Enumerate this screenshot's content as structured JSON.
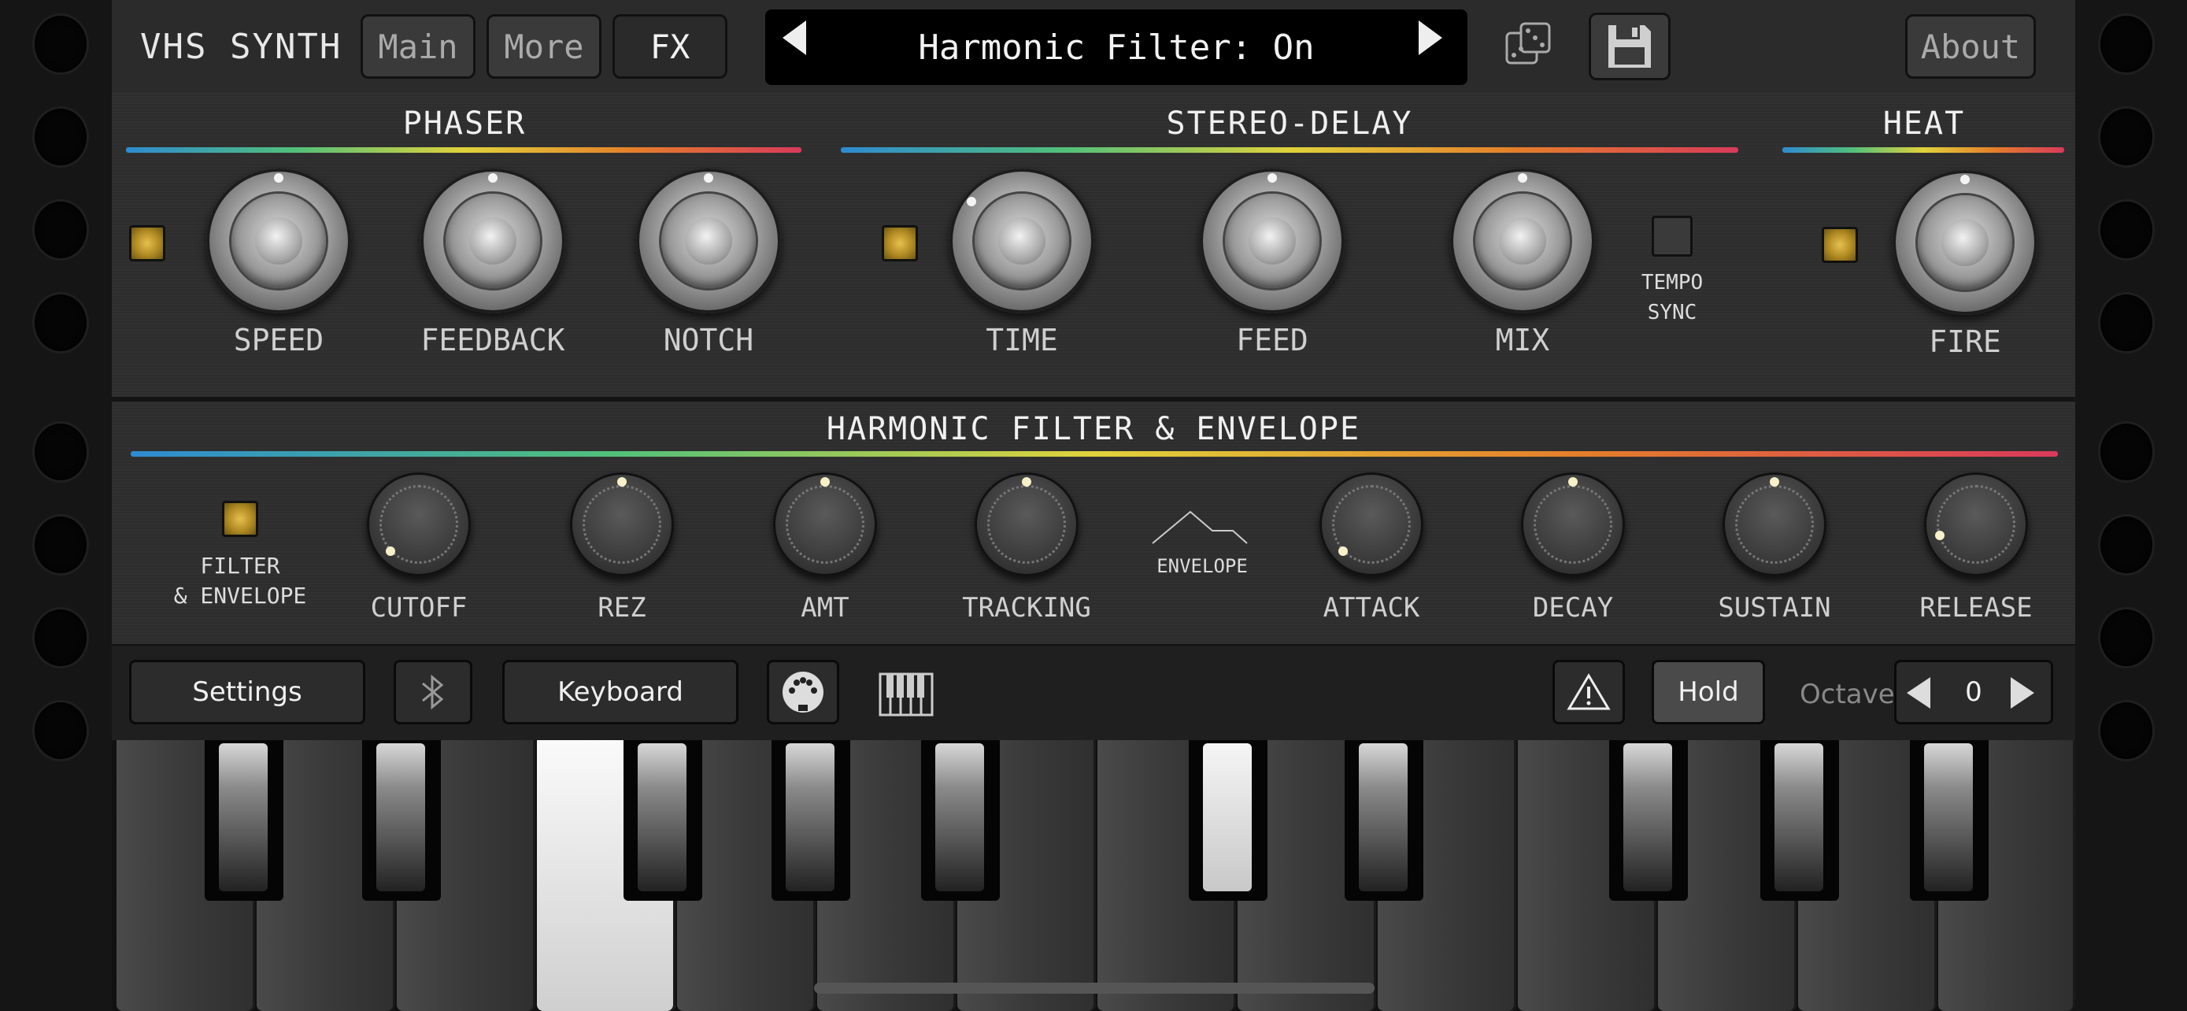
{
  "app": {
    "title": "VHS SYNTH"
  },
  "tabs": [
    {
      "label": "Main",
      "active": false
    },
    {
      "label": "More",
      "active": false
    },
    {
      "label": "FX",
      "active": true
    }
  ],
  "preset": {
    "name": "Harmonic Filter: On",
    "prev_icon": "triangle-left",
    "next_icon": "triangle-right"
  },
  "icons": {
    "random": "dice-icon",
    "save": "floppy-disk-icon",
    "bluetooth": "bluetooth-icon",
    "midi": "midi-din-icon",
    "piano": "piano-icon",
    "warning": "warning-icon"
  },
  "about_label": "About",
  "phaser": {
    "title": "PHASER",
    "enabled": true,
    "knobs": [
      {
        "label": "SPEED"
      },
      {
        "label": "FEEDBACK"
      },
      {
        "label": "NOTCH"
      }
    ]
  },
  "stereo_delay": {
    "title": "STEREO-DELAY",
    "enabled": true,
    "knobs": [
      {
        "label": "TIME"
      },
      {
        "label": "FEED"
      },
      {
        "label": "MIX"
      }
    ],
    "tempo_sync": {
      "label_line1": "TEMPO",
      "label_line2": "SYNC",
      "enabled": false
    }
  },
  "heat": {
    "title": "HEAT",
    "enabled": true,
    "knobs": [
      {
        "label": "FIRE"
      }
    ]
  },
  "filter_env": {
    "title": "HARMONIC FILTER & ENVELOPE",
    "enabled": true,
    "toggle_label_line1": "FILTER",
    "toggle_label_line2": "& ENVELOPE",
    "envelope_label": "ENVELOPE",
    "knobs": [
      {
        "label": "CUTOFF"
      },
      {
        "label": "REZ"
      },
      {
        "label": "AMT"
      },
      {
        "label": "TRACKING"
      },
      {
        "label": "ATTACK"
      },
      {
        "label": "DECAY"
      },
      {
        "label": "SUSTAIN"
      },
      {
        "label": "RELEASE"
      }
    ]
  },
  "toolbar": {
    "settings_label": "Settings",
    "keyboard_label": "Keyboard",
    "hold_label": "Hold",
    "octave_label": "Octave",
    "octave_value": "0"
  },
  "colors": {
    "accent_led": "#e6c04e",
    "rainbow": [
      "#2e8bd1",
      "#52c07a",
      "#e0d23b",
      "#e57f2a",
      "#d93a5a"
    ]
  }
}
